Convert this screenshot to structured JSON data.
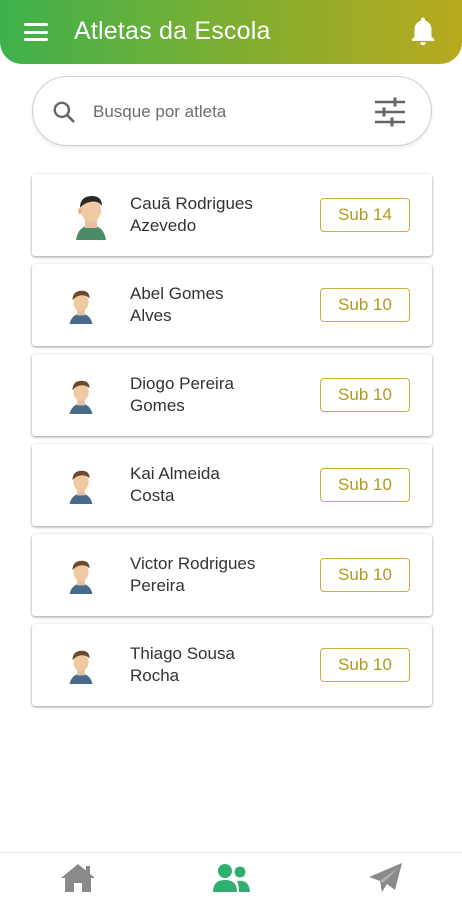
{
  "header": {
    "title": "Atletas da Escola"
  },
  "search": {
    "placeholder": "Busque por atleta"
  },
  "athletes": [
    {
      "name_line1": "Cauã Rodrigues",
      "name_line2": "Azevedo",
      "category": "Sub 14"
    },
    {
      "name_line1": "Abel Gomes",
      "name_line2": "Alves",
      "category": "Sub 10"
    },
    {
      "name_line1": "Diogo Pereira",
      "name_line2": "Gomes",
      "category": "Sub 10"
    },
    {
      "name_line1": "Kai Almeida",
      "name_line2": "Costa",
      "category": "Sub 10"
    },
    {
      "name_line1": "Victor Rodrigues",
      "name_line2": "Pereira",
      "category": "Sub 10"
    },
    {
      "name_line1": "Thiago Sousa",
      "name_line2": "Rocha",
      "category": "Sub 10"
    }
  ],
  "bottom_nav": {
    "items": [
      {
        "icon": "home-icon",
        "active": false
      },
      {
        "icon": "users-icon",
        "active": true
      },
      {
        "icon": "send-icon",
        "active": false
      }
    ]
  },
  "colors": {
    "header_gradient_start": "#3db14c",
    "header_gradient_end": "#b9a81f",
    "badge": "#c8b03a",
    "nav_active": "#2fb070",
    "nav_inactive": "#8a8a8a"
  }
}
